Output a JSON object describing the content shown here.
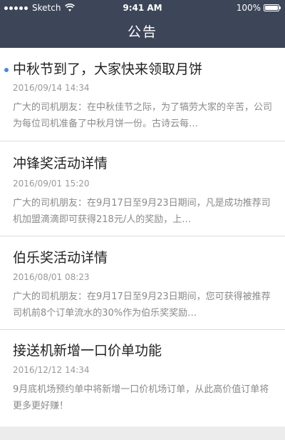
{
  "status_bar": {
    "carrier": "Sketch",
    "time": "9:41 AM",
    "battery": "100%",
    "signal_icon": "signal-dots-icon",
    "wifi_icon": "wifi-icon",
    "battery_icon": "battery-icon"
  },
  "nav": {
    "title": "公告"
  },
  "colors": {
    "header_bg": "#3d4658",
    "unread_dot": "#4a86e8",
    "title_text": "#222222",
    "meta_text": "#999999"
  },
  "notices": [
    {
      "title": "中秋节到了，大家快来领取月饼",
      "date": "2016/09/14 14:34",
      "summary": "广大的司机朋友：在中秋佳节之际，为了犒劳大家的辛苦，公司为每位司机准备了中秋月饼一份。古诗云每…",
      "unread": true
    },
    {
      "title": "冲锋奖活动详情",
      "date": "2016/09/01 15:20",
      "summary": "广大的司机朋友：在9月17日至9月23日期间，凡是成功推荐司机加盟滴滴即可获得218元/人的奖励，上…",
      "unread": false
    },
    {
      "title": "伯乐奖活动详情",
      "date": "2016/08/01 08:23",
      "summary": "广大的司机朋友：在9月17日至9月23日期间，您可获得被推荐司机前8个订单流水的30%作为伯乐奖奖励…",
      "unread": false
    },
    {
      "title": "接送机新增一口价单功能",
      "date": "2016/12/12 14:34",
      "summary": "9月底机场预约单中将新增一口价机场订单，从此高价值订单将更多更好赚！",
      "unread": false
    }
  ]
}
